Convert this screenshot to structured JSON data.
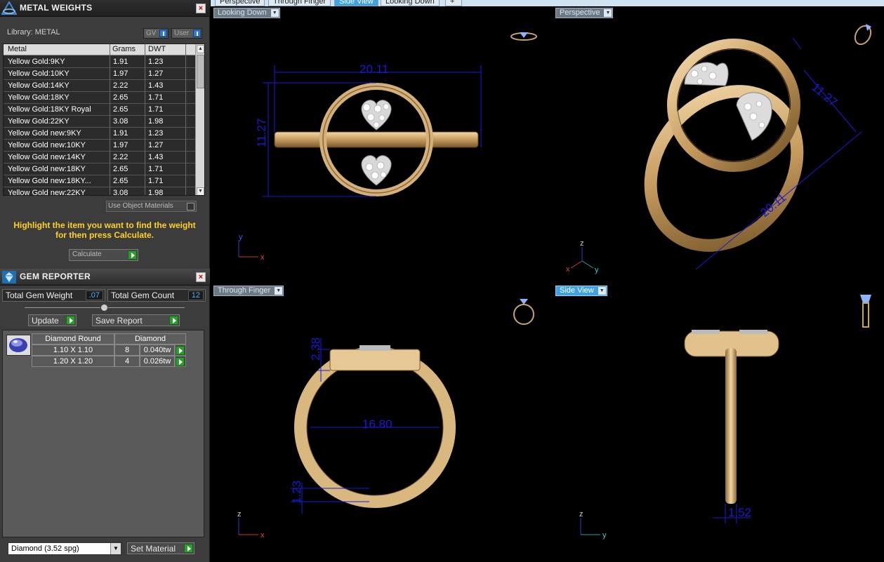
{
  "metal_panel": {
    "title": "METAL WEIGHTS",
    "library_label": "Library: METAL",
    "toggle_gv": "GV",
    "toggle_user": "User",
    "columns": [
      "Metal",
      "Grams",
      "DWT"
    ],
    "rows": [
      {
        "metal": "Yellow Gold:9KY",
        "grams": "1.91",
        "dwt": "1.23"
      },
      {
        "metal": "Yellow Gold:10KY",
        "grams": "1.97",
        "dwt": "1.27"
      },
      {
        "metal": "Yellow Gold:14KY",
        "grams": "2.22",
        "dwt": "1.43"
      },
      {
        "metal": "Yellow Gold:18KY",
        "grams": "2.65",
        "dwt": "1.71"
      },
      {
        "metal": "Yellow Gold:18KY Royal",
        "grams": "2.65",
        "dwt": "1.71"
      },
      {
        "metal": "Yellow Gold:22KY",
        "grams": "3.08",
        "dwt": "1.98"
      },
      {
        "metal": "Yellow Gold new:9KY",
        "grams": "1.91",
        "dwt": "1.23"
      },
      {
        "metal": "Yellow Gold new:10KY",
        "grams": "1.97",
        "dwt": "1.27"
      },
      {
        "metal": "Yellow Gold new:14KY",
        "grams": "2.22",
        "dwt": "1.43"
      },
      {
        "metal": "Yellow Gold new:18KY",
        "grams": "2.65",
        "dwt": "1.71"
      },
      {
        "metal": "Yellow Gold new:18KY...",
        "grams": "2.65",
        "dwt": "1.71"
      },
      {
        "metal": "Yellow Gold new:22KY",
        "grams": "3.08",
        "dwt": "1.98"
      }
    ],
    "use_object_materials": "Use Object Materials",
    "hint": "Highlight the item you want to find the weight for then press Calculate.",
    "calculate_label": "Calculate"
  },
  "gem_panel": {
    "title": "GEM REPORTER",
    "total_weight_label": "Total Gem Weight",
    "total_weight_value": ".07",
    "total_count_label": "Total Gem Count",
    "total_count_value": "12",
    "update_label": "Update",
    "save_report_label": "Save Report",
    "table_headers": [
      "Diamond Round",
      "Diamond"
    ],
    "rows": [
      {
        "size": "1.10 X 1.10",
        "count": "8",
        "weight": "0.040tw"
      },
      {
        "size": "1.20 X 1.20",
        "count": "4",
        "weight": "0.026tw"
      }
    ],
    "material_select": "Diamond     (3.52 spg)",
    "set_material_label": "Set Material"
  },
  "tabs": [
    "Perspective",
    "Through Finger",
    "Side View",
    "Looking Down"
  ],
  "active_tab": "Side View",
  "viewports": {
    "top_left": {
      "label": "Looking Down",
      "dim_width": "20.11",
      "dim_height": "11.27",
      "axis_up": "y",
      "axis_right": "x"
    },
    "top_right": {
      "label": "Perspective",
      "dim_long": "20.11",
      "dim_short": "11.27",
      "axis_up": "z",
      "axis_left": "x",
      "axis_right": "y"
    },
    "bottom_left": {
      "label": "Through Finger",
      "dim_inner": "16.80",
      "dim_top": "2.38",
      "dim_band": "1.23",
      "axis_up": "z",
      "axis_right": "x"
    },
    "bottom_right": {
      "label": "Side View",
      "dim_band": "1.52",
      "axis_up": "z",
      "axis_right": "y"
    }
  },
  "colors": {
    "accent": "#3ea3e0",
    "hint": "#ffd21f",
    "gold": "#c9a46a",
    "dimension": "#1a1ad6"
  },
  "icons": [
    "metal-weights-icon",
    "gem-reporter-icon",
    "close-icon",
    "play-icon",
    "ring-preview-icon"
  ]
}
